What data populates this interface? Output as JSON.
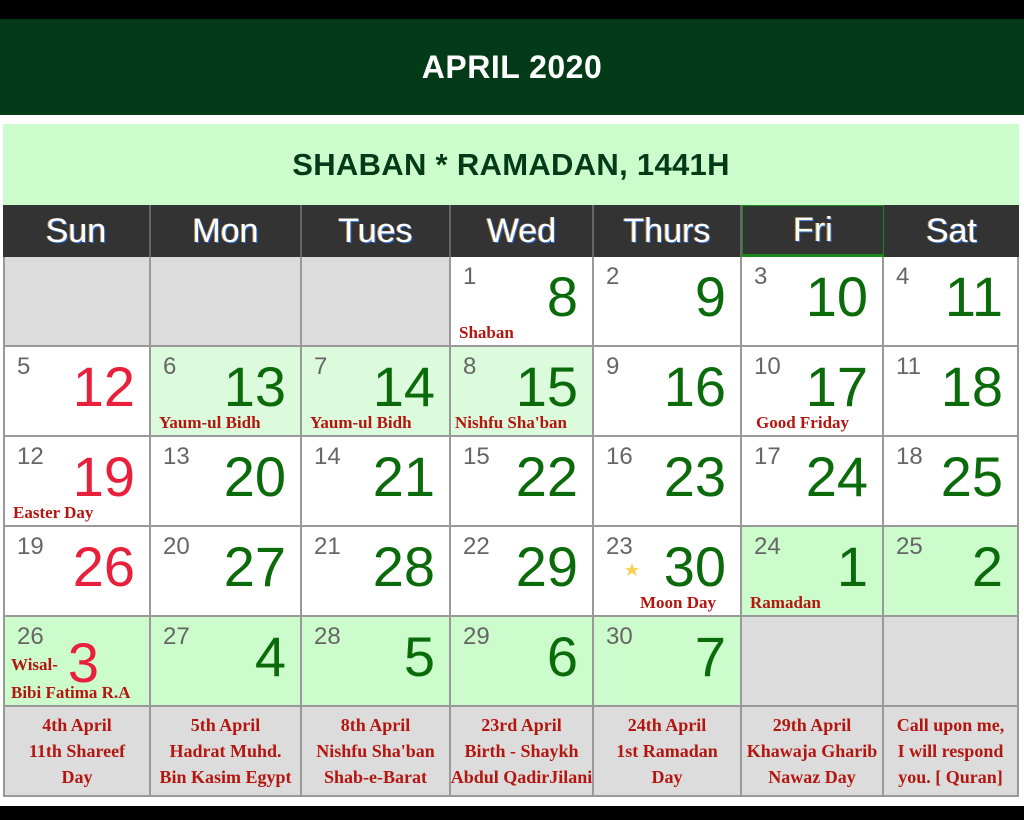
{
  "header": {
    "title": "APRIL 2020",
    "subtitle": "SHABAN * RAMADAN, 1441H"
  },
  "colors": {
    "title_band": "#033a17",
    "hijri_band": "#ccfccc",
    "hijri_number": "#0b6b0b",
    "holiday_number": "#e8203c",
    "note_text": "#b3160f",
    "header_row": "#333333",
    "empty_cell": "#dcdcdc"
  },
  "weekdays": [
    "Sun",
    "Mon",
    "Tues",
    "Wed",
    "Thurs",
    "Fri",
    "Sat"
  ],
  "weeks": [
    [
      {
        "empty": true
      },
      {
        "empty": true
      },
      {
        "empty": true
      },
      {
        "gregorian": "1",
        "hijri": "8",
        "note": "Shaban",
        "bg": "white"
      },
      {
        "gregorian": "2",
        "hijri": "9",
        "bg": "white"
      },
      {
        "gregorian": "3",
        "hijri": "10",
        "bg": "white"
      },
      {
        "gregorian": "4",
        "hijri": "11",
        "bg": "white"
      }
    ],
    [
      {
        "gregorian": "5",
        "hijri": "12",
        "red": true,
        "bg": "white"
      },
      {
        "gregorian": "6",
        "hijri": "13",
        "note": "Yaum-ul Bidh",
        "bg": "light"
      },
      {
        "gregorian": "7",
        "hijri": "14",
        "note": "Yaum-ul Bidh",
        "bg": "light"
      },
      {
        "gregorian": "8",
        "hijri": "15",
        "note": "Nishfu Sha'ban",
        "bg": "light"
      },
      {
        "gregorian": "9",
        "hijri": "16",
        "bg": "white"
      },
      {
        "gregorian": "10",
        "hijri": "17",
        "note": "Good Friday",
        "bg": "white"
      },
      {
        "gregorian": "11",
        "hijri": "18",
        "bg": "white"
      }
    ],
    [
      {
        "gregorian": "12",
        "hijri": "19",
        "red": true,
        "note": "Easter Day",
        "bg": "white"
      },
      {
        "gregorian": "13",
        "hijri": "20",
        "bg": "white"
      },
      {
        "gregorian": "14",
        "hijri": "21",
        "bg": "white"
      },
      {
        "gregorian": "15",
        "hijri": "22",
        "bg": "white"
      },
      {
        "gregorian": "16",
        "hijri": "23",
        "bg": "white"
      },
      {
        "gregorian": "17",
        "hijri": "24",
        "bg": "white"
      },
      {
        "gregorian": "18",
        "hijri": "25",
        "bg": "white"
      }
    ],
    [
      {
        "gregorian": "19",
        "hijri": "26",
        "red": true,
        "bg": "white"
      },
      {
        "gregorian": "20",
        "hijri": "27",
        "bg": "white"
      },
      {
        "gregorian": "21",
        "hijri": "28",
        "bg": "white"
      },
      {
        "gregorian": "22",
        "hijri": "29",
        "bg": "white"
      },
      {
        "gregorian": "23",
        "hijri": "30",
        "note": "Moon Day",
        "icon": "crescent-moon-star-icon",
        "bg": "white"
      },
      {
        "gregorian": "24",
        "hijri": "1",
        "note": "Ramadan",
        "bg": "green"
      },
      {
        "gregorian": "25",
        "hijri": "2",
        "bg": "green"
      }
    ],
    [
      {
        "gregorian": "26",
        "hijri": "3",
        "red": true,
        "note": "Wisal-",
        "note2": "Bibi Fatima R.A",
        "bg": "green"
      },
      {
        "gregorian": "27",
        "hijri": "4",
        "bg": "green"
      },
      {
        "gregorian": "28",
        "hijri": "5",
        "bg": "green"
      },
      {
        "gregorian": "29",
        "hijri": "6",
        "bg": "green"
      },
      {
        "gregorian": "30",
        "hijri": "7",
        "bg": "green"
      },
      {
        "empty": true
      },
      {
        "empty": true
      }
    ]
  ],
  "footer": [
    [
      "4th April",
      "11th Shareef",
      "Day"
    ],
    [
      "5th April",
      "Hadrat Muhd.",
      "Bin Kasim Egypt"
    ],
    [
      "8th April",
      "Nishfu Sha'ban",
      "Shab-e-Barat"
    ],
    [
      "23rd April",
      "Birth - Shaykh",
      "Abdul QadirJilani"
    ],
    [
      "24th April",
      "1st Ramadan",
      "Day"
    ],
    [
      "29th April",
      "Khawaja Gharib",
      "Nawaz Day"
    ],
    [
      "Call upon me,",
      "I will respond",
      "you. [ Quran]"
    ]
  ]
}
